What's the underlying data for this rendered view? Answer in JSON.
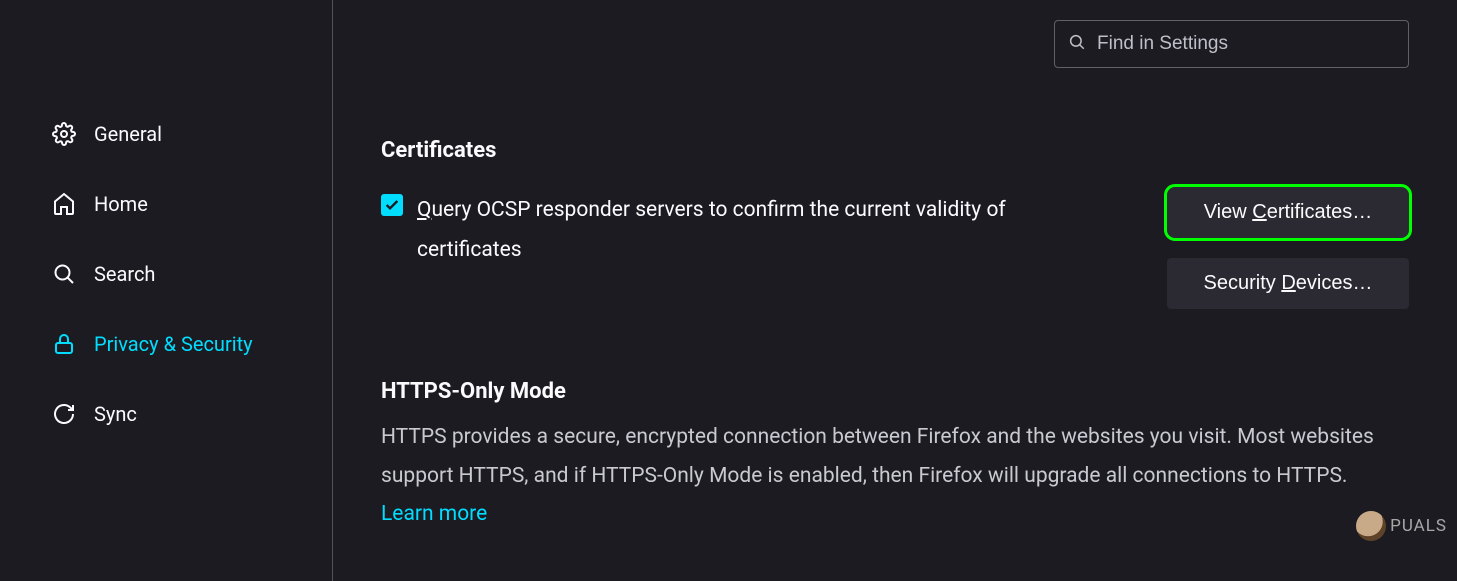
{
  "search": {
    "placeholder": "Find in Settings"
  },
  "sidebar": {
    "items": [
      {
        "label": "General",
        "icon": "gear-icon",
        "active": false
      },
      {
        "label": "Home",
        "icon": "home-icon",
        "active": false
      },
      {
        "label": "Search",
        "icon": "search-icon",
        "active": false
      },
      {
        "label": "Privacy & Security",
        "icon": "lock-icon",
        "active": true
      },
      {
        "label": "Sync",
        "icon": "sync-icon",
        "active": false
      }
    ]
  },
  "certificates": {
    "heading": "Certificates",
    "ocsp_checked": true,
    "ocsp_prefix": "Q",
    "ocsp_rest": "uery OCSP responder servers to confirm the current validity of certificates",
    "view_prefix": "View ",
    "view_accel": "C",
    "view_suffix": "ertificates…",
    "devices_prefix": "Security ",
    "devices_accel": "D",
    "devices_suffix": "evices…"
  },
  "https_mode": {
    "heading": "HTTPS-Only Mode",
    "body": "HTTPS provides a secure, encrypted connection between Firefox and the websites you visit. Most websites support HTTPS, and if HTTPS-Only Mode is enabled, then Firefox will upgrade all connections to HTTPS.",
    "learn_more": "Learn more"
  },
  "watermark": {
    "text": "PUALS"
  }
}
